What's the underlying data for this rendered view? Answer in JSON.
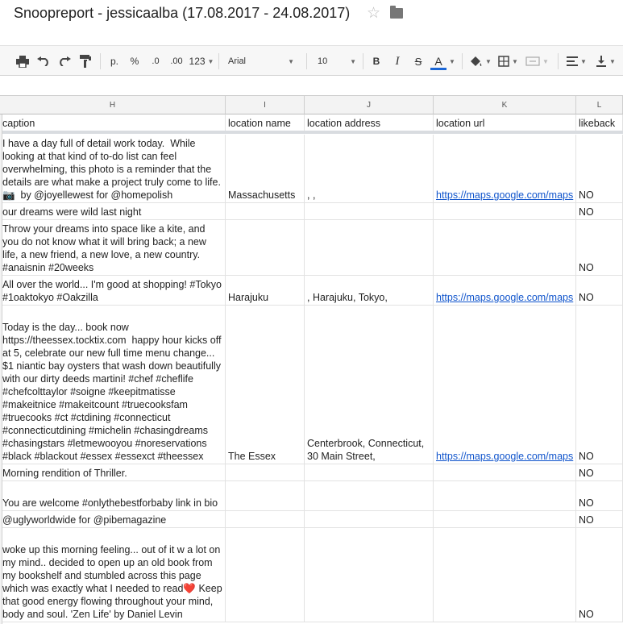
{
  "document": {
    "title": "Snoopreport - jessicaalba (17.08.2017 - 24.08.2017)",
    "star_icon": "star-outline-icon",
    "folder_icon": "folder-icon"
  },
  "toolbar": {
    "print_icon": "print-icon",
    "undo_icon": "undo-icon",
    "redo_icon": "redo-icon",
    "paint_format_icon": "paint-format-icon",
    "currency_label": "р.",
    "percent_label": "%",
    "decrease_decimal_label": ".0",
    "increase_decimal_label": ".00",
    "more_formats_label": "123",
    "font_family": "Arial",
    "font_size": "10",
    "bold_label": "B",
    "italic_label": "I",
    "strike_label": "S",
    "text_color_label": "A",
    "text_color": "#1a66d6",
    "fill_color_icon": "fill-color-icon",
    "borders_icon": "borders-icon",
    "merge_icon": "merge-cells-icon",
    "align_icon": "align-left-icon",
    "valign_icon": "vertical-align-bottom-icon"
  },
  "columns": [
    {
      "letter": "H"
    },
    {
      "letter": "I"
    },
    {
      "letter": "J"
    },
    {
      "letter": "K"
    },
    {
      "letter": "L"
    }
  ],
  "header": {
    "caption": "caption",
    "location_name": "location name",
    "location_address": "location address",
    "location_url": "location url",
    "likeback": "likeback"
  },
  "rows": [
    {
      "caption": "I have a day full of detail work today.  While looking at that kind of to-do list can feel overwhelming, this photo is a reminder that the details are what make a project truly come to life. 📷  by @joyellewest for @homepolish",
      "location_name": "Massachusetts",
      "location_address": ", ,",
      "location_url": "https://maps.google.com/maps",
      "likeback": "NO"
    },
    {
      "caption": "our dreams were wild last night",
      "location_name": "",
      "location_address": "",
      "location_url": "",
      "likeback": "NO"
    },
    {
      "caption": "Throw your dreams into space like a kite, and you do not know what it will bring back; a new life, a new friend, a new love, a new country. #anaisnin #20weeks",
      "location_name": "",
      "location_address": "",
      "location_url": "",
      "likeback": "NO"
    },
    {
      "caption": "All over the world... I'm good at shopping! #Tokyo #1oaktokyo #Oakzilla",
      "location_name": "Harajuku",
      "location_address": ", Harajuku, Tokyo,",
      "location_url": "https://maps.google.com/maps",
      "likeback": "NO"
    },
    {
      "caption": "Today is the day... book now https://theessex.tocktix.com  happy hour kicks off at 5, celebrate our new full time menu change... $1 niantic bay oysters that wash down beautifully with our dirty deeds martini! #chef #cheflife #chefcolttaylor #soigne #keepitmatisse #makeitnice #makeitcount #truecooksfam #truecooks #ct #ctdining #connecticut #connecticutdining #michelin #chasingdreams #chasingstars #letmewooyou #noreservations #black #blackout #essex #essexct #theessex",
      "location_name": "The Essex",
      "location_address": "Centerbrook, Connecticut, 30 Main Street,",
      "location_url": "https://maps.google.com/maps",
      "likeback": "NO"
    },
    {
      "caption": "Morning rendition of Thriller.",
      "location_name": "",
      "location_address": "",
      "location_url": "",
      "likeback": "NO"
    },
    {
      "caption": "You are welcome #onlythebestforbaby link in bio",
      "location_name": "",
      "location_address": "",
      "location_url": "",
      "likeback": "NO"
    },
    {
      "caption": "@uglyworldwide for @pibemagazine",
      "location_name": "",
      "location_address": "",
      "location_url": "",
      "likeback": "NO"
    },
    {
      "caption": "woke up this morning feeling... out of it w a lot on my mind.. decided to open up an old book from my bookshelf and stumbled across this page which was exactly what I needed to read❤️ Keep that good energy flowing throughout your mind, body and soul. 'Zen Life' by Daniel Levin",
      "location_name": "",
      "location_address": "",
      "location_url": "",
      "likeback": "NO"
    }
  ]
}
